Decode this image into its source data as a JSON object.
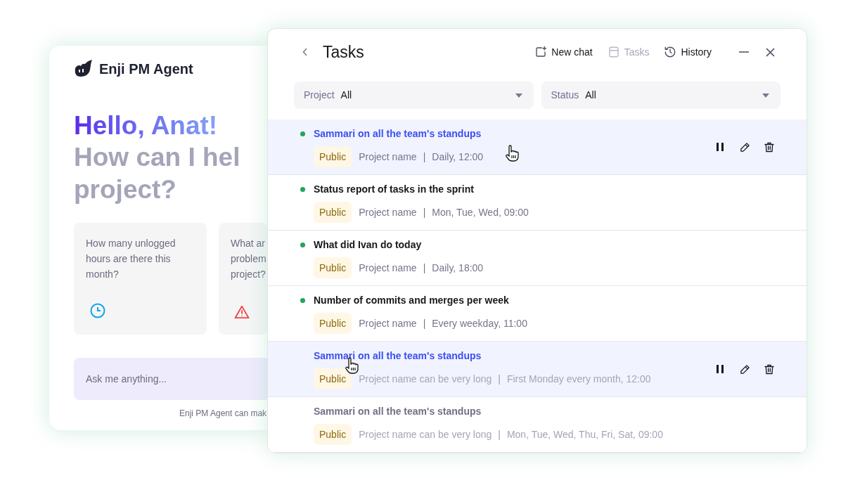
{
  "agent_card": {
    "brand": "Enji PM Agent",
    "greeting": "Hello, Anat!",
    "question_lines": [
      "How can I hel",
      "project?"
    ],
    "suggestions": [
      {
        "lines": [
          "How many unlogged",
          "hours are there this",
          "month?"
        ],
        "kind": "clock"
      },
      {
        "lines": [
          "What ar",
          "problem",
          "project?"
        ],
        "kind": "warning"
      }
    ],
    "input": {
      "placeholder": "Ask me anything..."
    },
    "disclaimer": "Enji PM Agent can mak"
  },
  "tasks_panel": {
    "title": "Tasks",
    "header_buttons": [
      {
        "label": "New chat",
        "disabled": false
      },
      {
        "label": "Tasks",
        "disabled": true
      },
      {
        "label": "History",
        "disabled": false
      }
    ],
    "filters": [
      {
        "label": "Project",
        "value": "All"
      },
      {
        "label": "Status",
        "value": "All"
      }
    ],
    "tasks": [
      {
        "title": "Sammari on all the team's standups",
        "badge": "Public",
        "project": "Project name",
        "separator": "|",
        "schedule": "Daily, 12:00",
        "active": true,
        "hovered": true
      },
      {
        "title": "Status report of tasks in the sprint",
        "badge": "Public",
        "project": "Project name",
        "separator": "|",
        "schedule": "Mon, Tue, Wed,  09:00",
        "active": true,
        "hovered": false
      },
      {
        "title": "What did Ivan do today",
        "badge": "Public",
        "project": "Project name",
        "separator": "|",
        "schedule": "Daily, 18:00",
        "active": true,
        "hovered": false
      },
      {
        "title": "Number of commits and merges per week",
        "badge": "Public",
        "project": "Project name",
        "separator": "|",
        "schedule": "Every weekday, 11:00",
        "active": true,
        "hovered": false
      },
      {
        "title": "Sammari on all the team's standups",
        "badge": "Public",
        "project": "Project name can be very long",
        "separator": "|",
        "schedule": "First Monday every month, 12:00",
        "active": false,
        "hovered": true
      },
      {
        "title": "Sammari on all the team's standups",
        "badge": "Public",
        "project": "Project name can be very long",
        "separator": "|",
        "schedule": "Mon, Tue, Wed, Thu, Fri, Sat, 09:00",
        "active": false,
        "hovered": false
      }
    ]
  }
}
